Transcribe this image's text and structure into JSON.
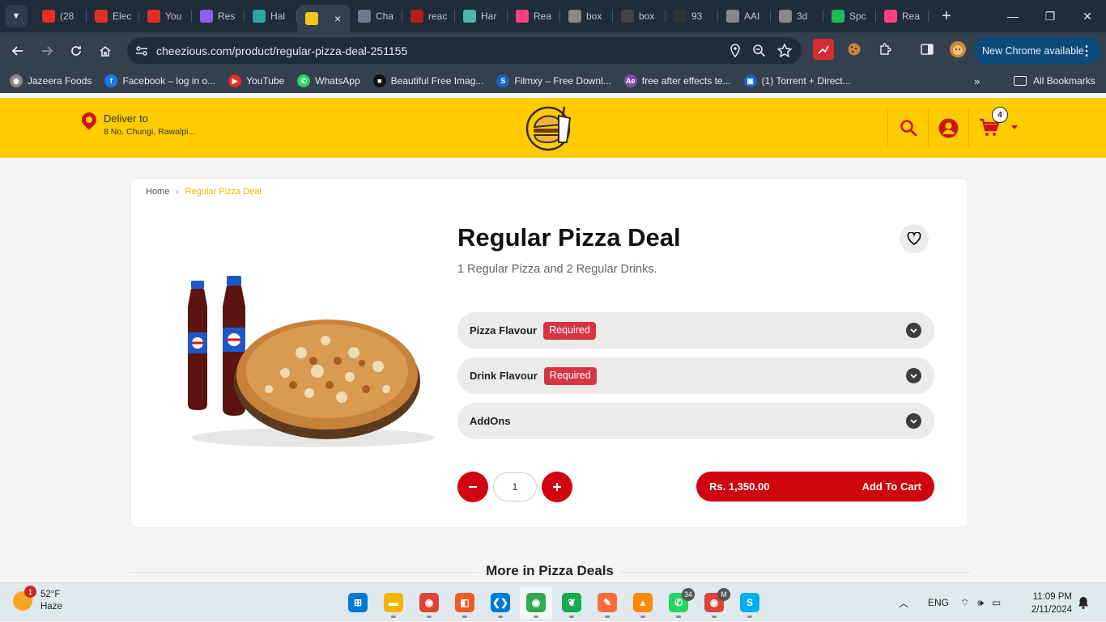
{
  "browser": {
    "tabs": [
      {
        "label": "(28",
        "color": "#e52d27"
      },
      {
        "label": "Elec",
        "color": "#e52d27"
      },
      {
        "label": "You",
        "color": "#e52d27"
      },
      {
        "label": "Res",
        "color": "#8e5df4"
      },
      {
        "label": "Hal",
        "color": "#2aa8a0"
      },
      {
        "label": "",
        "color": "#f5c518",
        "active": true
      },
      {
        "label": "Cha",
        "color": "#6b7c8e"
      },
      {
        "label": "reac",
        "color": "#b71c1c"
      },
      {
        "label": "Har",
        "color": "#4db6ac"
      },
      {
        "label": "Rea",
        "color": "#ff4081"
      },
      {
        "label": "box",
        "color": "#888888"
      },
      {
        "label": "box",
        "color": "#444444"
      },
      {
        "label": "93",
        "color": "#333333"
      },
      {
        "label": "AAI",
        "color": "#888888"
      },
      {
        "label": "3d",
        "color": "#888888"
      },
      {
        "label": "Spc",
        "color": "#1db954"
      },
      {
        "label": "Rea",
        "color": "#ff4081"
      }
    ],
    "tab_close_glyph": "×",
    "new_tab_glyph": "+",
    "window_controls": [
      "—",
      "❐",
      "✕"
    ],
    "url": "cheezious.com/product/regular-pizza-deal-251155",
    "update_banner": "New Chrome available",
    "bookmarks": [
      {
        "label": "Jazeera Foods",
        "color": "#888888",
        "glyph": "◉"
      },
      {
        "label": "Facebook – log in o...",
        "color": "#1877f2",
        "glyph": "f"
      },
      {
        "label": "YouTube",
        "color": "#e52d27",
        "glyph": "▶"
      },
      {
        "label": "WhatsApp",
        "color": "#25d366",
        "glyph": "✆"
      },
      {
        "label": "Beautiful Free Imag...",
        "color": "#111111",
        "glyph": "■"
      },
      {
        "label": "Filmxy – Free Downl...",
        "color": "#1565c0",
        "glyph": "S"
      },
      {
        "label": "free after effects te...",
        "color": "#7b4fb0",
        "glyph": "Ae"
      },
      {
        "label": "(1) Torrent + Direct...",
        "color": "#1565c0",
        "glyph": "▣"
      }
    ],
    "bookmarks_overflow": "»",
    "all_bookmarks": "All Bookmarks"
  },
  "site": {
    "deliver_label": "Deliver to",
    "deliver_address": "8 No. Chungi, Rawalpi...",
    "cart_count": "4",
    "breadcrumb": {
      "home": "Home",
      "separator": "›",
      "current": "Regular Pizza Deal"
    },
    "product": {
      "title": "Regular Pizza Deal",
      "description": "1 Regular Pizza and 2 Regular Drinks.",
      "options": [
        {
          "label": "Pizza Flavour",
          "badge": "Required"
        },
        {
          "label": "Drink Flavour",
          "badge": "Required"
        },
        {
          "label": "AddOns",
          "badge": ""
        }
      ],
      "quantity": "1",
      "price": "Rs. 1,350.00",
      "add_to_cart": "Add To Cart"
    },
    "more_section_title": "More in Pizza Deals",
    "colors": {
      "brand_yellow": "#ffcc02",
      "brand_red": "#d0050f",
      "required_badge": "#d63343"
    }
  },
  "taskbar": {
    "weather_temp": "52°F",
    "weather_desc": "Haze",
    "weather_badge": "1",
    "apps": [
      {
        "name": "windows-start-icon",
        "color": "#0078d4",
        "glyph": "⊞"
      },
      {
        "name": "file-explorer-icon",
        "color": "#f2b600",
        "glyph": "▬"
      },
      {
        "name": "chrome-icon",
        "color": "#db4437",
        "glyph": "◉"
      },
      {
        "name": "postman-icon",
        "color": "#ef5b25",
        "glyph": "◧"
      },
      {
        "name": "vscode-icon",
        "color": "#0078d4",
        "glyph": "❮❯"
      },
      {
        "name": "chrome-profile-icon",
        "color": "#34a853",
        "glyph": "◉",
        "active": true
      },
      {
        "name": "mongodb-icon",
        "color": "#13aa52",
        "glyph": "❦"
      },
      {
        "name": "postman-orange-icon",
        "color": "#ff6c37",
        "glyph": "✎"
      },
      {
        "name": "vlc-icon",
        "color": "#ff8800",
        "glyph": "▲"
      },
      {
        "name": "whatsapp-icon",
        "color": "#25d366",
        "glyph": "✆",
        "badge": "34"
      },
      {
        "name": "chrome-m-icon",
        "color": "#db4437",
        "glyph": "◉",
        "badge": "M"
      },
      {
        "name": "skype-icon",
        "color": "#00aff0",
        "glyph": "S"
      }
    ],
    "tray_chevron": "︿",
    "language": "ENG",
    "wifi": "⌔",
    "volume": "🕪",
    "battery": "▭",
    "time": "11:09 PM",
    "date": "2/11/2024",
    "notifications_icon": "🔔"
  }
}
